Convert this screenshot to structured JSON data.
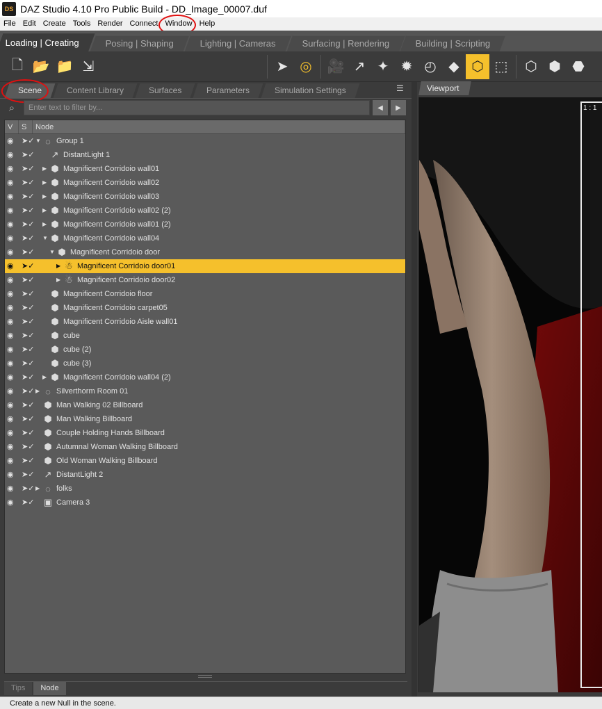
{
  "window": {
    "title": "DAZ Studio 4.10 Pro Public Build - DD_Image_00007.duf",
    "logo_text": "DS"
  },
  "menu": [
    "File",
    "Edit",
    "Create",
    "Tools",
    "Render",
    "Connect",
    "Window",
    "Help"
  ],
  "activity_tabs": [
    "Loading | Creating",
    "Posing | Shaping",
    "Lighting | Cameras",
    "Surfacing | Rendering",
    "Building | Scripting"
  ],
  "pane_tabs": [
    "Scene",
    "Content Library",
    "Surfaces",
    "Parameters",
    "Simulation Settings"
  ],
  "filter": {
    "placeholder": "Enter text to filter by..."
  },
  "columns": {
    "v": "V",
    "s": "S",
    "node": "Node"
  },
  "tree_rows": [
    {
      "label": "Group 1",
      "level": 0,
      "expander": "down",
      "icon": "null-group-icon"
    },
    {
      "label": "DistantLight 1",
      "level": 1,
      "expander": "none",
      "icon": "distant-light-icon"
    },
    {
      "label": "Magnificent Corridoio wall01",
      "level": 1,
      "expander": "right",
      "icon": "prop-cube-icon"
    },
    {
      "label": "Magnificent Corridoio wall02",
      "level": 1,
      "expander": "right",
      "icon": "prop-cube-icon"
    },
    {
      "label": "Magnificent Corridoio wall03",
      "level": 1,
      "expander": "right",
      "icon": "prop-cube-icon"
    },
    {
      "label": "Magnificent Corridoio wall02 (2)",
      "level": 1,
      "expander": "right",
      "icon": "prop-cube-icon"
    },
    {
      "label": "Magnificent Corridoio wall01 (2)",
      "level": 1,
      "expander": "right",
      "icon": "prop-cube-icon"
    },
    {
      "label": "Magnificent Corridoio wall04",
      "level": 1,
      "expander": "down",
      "icon": "prop-cube-icon"
    },
    {
      "label": "Magnificent Corridoio door",
      "level": 2,
      "expander": "down",
      "icon": "prop-cube-icon"
    },
    {
      "label": "Magnificent Corridoio door01",
      "level": 3,
      "expander": "right",
      "icon": "bone-figure-icon",
      "selected": true
    },
    {
      "label": "Magnificent Corridoio door02",
      "level": 3,
      "expander": "right",
      "icon": "bone-figure-icon"
    },
    {
      "label": "Magnificent Corridoio floor",
      "level": 1,
      "expander": "none",
      "icon": "prop-cube-icon"
    },
    {
      "label": "Magnificent Corridoio carpet05",
      "level": 1,
      "expander": "none",
      "icon": "prop-cube-icon"
    },
    {
      "label": "Magnificent Corridoio Aisle wall01",
      "level": 1,
      "expander": "none",
      "icon": "prop-cube-icon"
    },
    {
      "label": "cube",
      "level": 1,
      "expander": "none",
      "icon": "prop-cube-icon"
    },
    {
      "label": "cube (2)",
      "level": 1,
      "expander": "none",
      "icon": "prop-cube-icon"
    },
    {
      "label": "cube (3)",
      "level": 1,
      "expander": "none",
      "icon": "prop-cube-icon"
    },
    {
      "label": "Magnificent Corridoio wall04 (2)",
      "level": 1,
      "expander": "right",
      "icon": "prop-cube-icon"
    },
    {
      "label": "Silverthorm Room 01",
      "level": 0,
      "expander": "right",
      "icon": "null-group-icon"
    },
    {
      "label": "Man Walking 02 Billboard",
      "level": 0,
      "expander": "none",
      "icon": "prop-cube-icon"
    },
    {
      "label": "Man Walking Billboard",
      "level": 0,
      "expander": "none",
      "icon": "prop-cube-icon"
    },
    {
      "label": "Couple Holding Hands Billboard",
      "level": 0,
      "expander": "none",
      "icon": "prop-cube-icon"
    },
    {
      "label": "Autumnal Woman Walking Billboard",
      "level": 0,
      "expander": "none",
      "icon": "prop-cube-icon"
    },
    {
      "label": "Old Woman Walking Billboard",
      "level": 0,
      "expander": "none",
      "icon": "prop-cube-icon"
    },
    {
      "label": "DistantLight 2",
      "level": 0,
      "expander": "none",
      "icon": "distant-light-icon"
    },
    {
      "label": "folks",
      "level": 0,
      "expander": "right",
      "icon": "null-group-icon"
    },
    {
      "label": "Camera 3",
      "level": 0,
      "expander": "none",
      "icon": "camera-icon"
    }
  ],
  "bottom_tabs": [
    "Tips",
    "Node"
  ],
  "viewport": {
    "tab": "Viewport",
    "aspect_label": "1 : 1"
  },
  "status": "Create a new Null in the scene.",
  "colors": {
    "selection": "#f5c02c",
    "annotation": "#e01010",
    "panel": "#5a5a5a"
  }
}
